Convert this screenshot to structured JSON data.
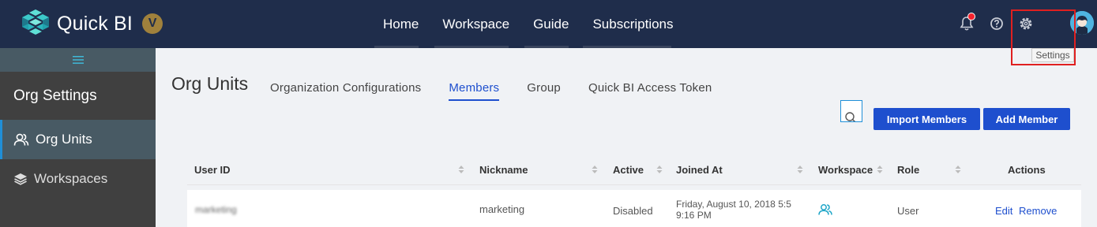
{
  "app": {
    "name": "Quick BI",
    "badge": "V"
  },
  "nav": [
    {
      "label": "Home"
    },
    {
      "label": "Workspace"
    },
    {
      "label": "Guide"
    },
    {
      "label": "Subscriptions"
    }
  ],
  "top_icons": {
    "notifications": "bell-icon",
    "help": "help-icon",
    "settings": "gear-icon",
    "avatar": "avatar"
  },
  "tooltip": {
    "settings": "Settings"
  },
  "sidebar": {
    "title": "Org Settings",
    "items": [
      {
        "label": "Org Units",
        "icon": "users-icon",
        "active": true
      },
      {
        "label": "Workspaces",
        "icon": "layers-icon",
        "active": false
      }
    ]
  },
  "page": {
    "title": "Org Units",
    "tabs": [
      {
        "label": "Organization Configurations",
        "active": false
      },
      {
        "label": "Members",
        "active": true
      },
      {
        "label": "Group",
        "active": false
      },
      {
        "label": "Quick BI Access Token",
        "active": false
      }
    ]
  },
  "actions": {
    "import_members": "Import Members",
    "add_member": "Add Member"
  },
  "table": {
    "columns": [
      "User ID",
      "Nickname",
      "Active",
      "Joined At",
      "Workspace",
      "Role",
      "Actions"
    ],
    "rows": [
      {
        "user_id": "marketing",
        "nickname": "marketing",
        "active": "Disabled",
        "joined_at_line1": "Friday, August 10, 2018 5:5",
        "joined_at_line2": "9:16 PM",
        "role": "User",
        "edit": "Edit",
        "remove": "Remove"
      }
    ]
  },
  "colors": {
    "topbar": "#1f2d4b",
    "accent": "#1e4fce",
    "sidebar": "#404040",
    "highlight": "#e02020"
  }
}
